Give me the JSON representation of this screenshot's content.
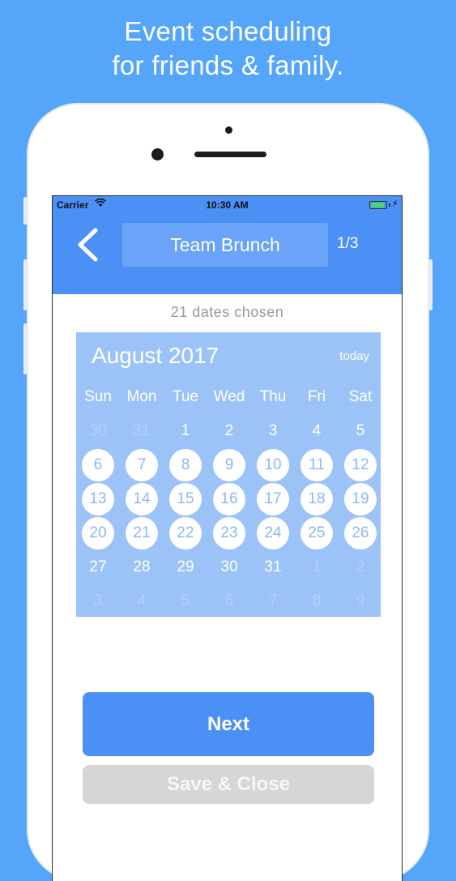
{
  "headline": {
    "line1": "Event scheduling",
    "line2": "for friends & family."
  },
  "status_bar": {
    "carrier": "Carrier",
    "time": "10:30 AM"
  },
  "navbar": {
    "title": "Team Brunch",
    "page_indicator": "1/3",
    "back_icon": "chevron-left-icon"
  },
  "dates_chosen": "21 dates chosen",
  "calendar": {
    "month_label": "August 2017",
    "today_label": "today",
    "weekdays": [
      "Sun",
      "Mon",
      "Tue",
      "Wed",
      "Thu",
      "Fri",
      "Sat"
    ],
    "weeks": [
      [
        {
          "label": "30",
          "state": "other"
        },
        {
          "label": "31",
          "state": "other"
        },
        {
          "label": "1",
          "state": "plain"
        },
        {
          "label": "2",
          "state": "plain"
        },
        {
          "label": "3",
          "state": "plain"
        },
        {
          "label": "4",
          "state": "plain"
        },
        {
          "label": "5",
          "state": "plain"
        }
      ],
      [
        {
          "label": "6",
          "state": "selected"
        },
        {
          "label": "7",
          "state": "selected"
        },
        {
          "label": "8",
          "state": "selected"
        },
        {
          "label": "9",
          "state": "selected"
        },
        {
          "label": "10",
          "state": "selected"
        },
        {
          "label": "11",
          "state": "selected"
        },
        {
          "label": "12",
          "state": "selected"
        }
      ],
      [
        {
          "label": "13",
          "state": "selected"
        },
        {
          "label": "14",
          "state": "selected"
        },
        {
          "label": "15",
          "state": "selected"
        },
        {
          "label": "16",
          "state": "selected"
        },
        {
          "label": "17",
          "state": "selected"
        },
        {
          "label": "18",
          "state": "selected"
        },
        {
          "label": "19",
          "state": "selected"
        }
      ],
      [
        {
          "label": "20",
          "state": "selected"
        },
        {
          "label": "21",
          "state": "selected"
        },
        {
          "label": "22",
          "state": "selected"
        },
        {
          "label": "23",
          "state": "selected"
        },
        {
          "label": "24",
          "state": "selected"
        },
        {
          "label": "25",
          "state": "selected"
        },
        {
          "label": "26",
          "state": "selected"
        }
      ],
      [
        {
          "label": "27",
          "state": "plain"
        },
        {
          "label": "28",
          "state": "plain"
        },
        {
          "label": "29",
          "state": "plain"
        },
        {
          "label": "30",
          "state": "plain"
        },
        {
          "label": "31",
          "state": "plain"
        },
        {
          "label": "1",
          "state": "other"
        },
        {
          "label": "2",
          "state": "other"
        }
      ],
      [
        {
          "label": "3",
          "state": "other"
        },
        {
          "label": "4",
          "state": "other"
        },
        {
          "label": "5",
          "state": "other"
        },
        {
          "label": "6",
          "state": "other"
        },
        {
          "label": "7",
          "state": "other"
        },
        {
          "label": "8",
          "state": "other"
        },
        {
          "label": "9",
          "state": "other"
        }
      ]
    ]
  },
  "buttons": {
    "next": "Next",
    "save_close": "Save & Close"
  },
  "colors": {
    "background": "#55a6fb",
    "accent": "#4a90f5",
    "calendar_bg": "#9cc3f7",
    "disabled": "#d6d6d6"
  }
}
